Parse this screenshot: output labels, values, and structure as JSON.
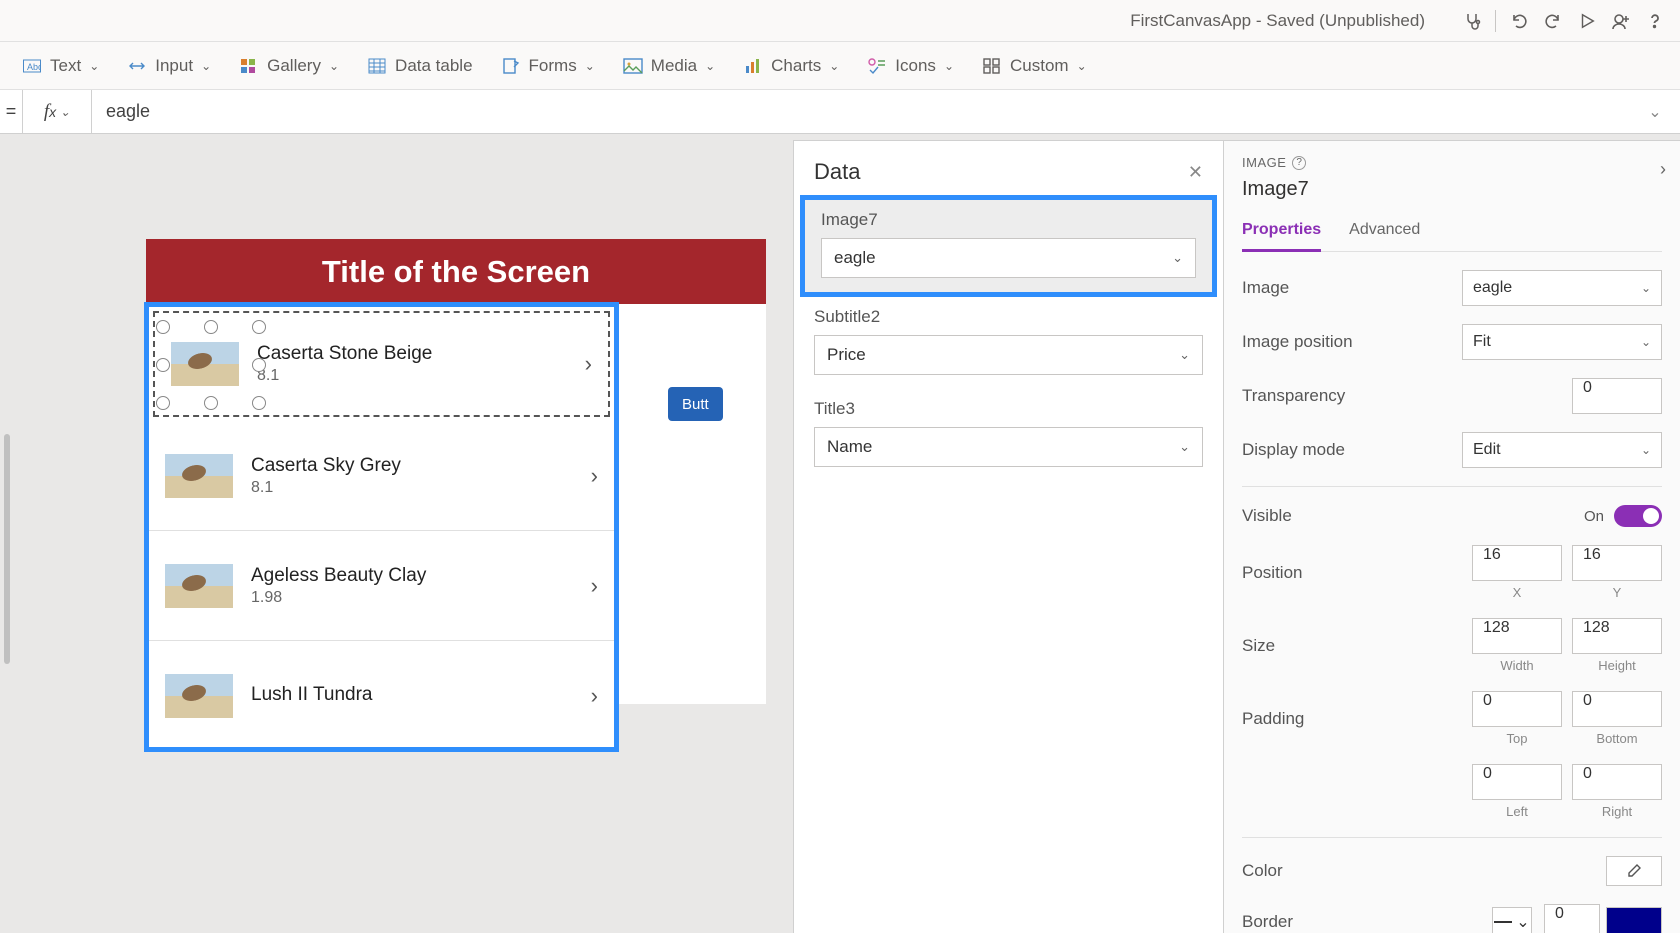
{
  "titlebar": {
    "app_title": "FirstCanvasApp - Saved (Unpublished)"
  },
  "ribbon": {
    "text": "Text",
    "input": "Input",
    "gallery": "Gallery",
    "datatable": "Data table",
    "forms": "Forms",
    "media": "Media",
    "charts": "Charts",
    "icons": "Icons",
    "custom": "Custom"
  },
  "formula": {
    "value": "eagle"
  },
  "canvas": {
    "header": "Title of the Screen",
    "button": "Butt",
    "rows": [
      {
        "title": "Caserta Stone Beige",
        "subtitle": "8.1"
      },
      {
        "title": "Caserta Sky Grey",
        "subtitle": "8.1"
      },
      {
        "title": "Ageless Beauty Clay",
        "subtitle": "1.98"
      },
      {
        "title": "Lush II Tundra",
        "subtitle": ""
      }
    ]
  },
  "data_panel": {
    "title": "Data",
    "groups": [
      {
        "label": "Image7",
        "value": "eagle"
      },
      {
        "label": "Subtitle2",
        "value": "Price"
      },
      {
        "label": "Title3",
        "value": "Name"
      }
    ]
  },
  "properties": {
    "type_label": "IMAGE",
    "control_name": "Image7",
    "tabs": {
      "properties": "Properties",
      "advanced": "Advanced"
    },
    "image_label": "Image",
    "image_value": "eagle",
    "position_label": "Image position",
    "position_value": "Fit",
    "transparency_label": "Transparency",
    "transparency_value": "0",
    "display_label": "Display mode",
    "display_value": "Edit",
    "visible_label": "Visible",
    "visible_value": "On",
    "pos_label": "Position",
    "pos_x": "16",
    "pos_y": "16",
    "x_label": "X",
    "y_label": "Y",
    "size_label": "Size",
    "size_w": "128",
    "size_h": "128",
    "w_label": "Width",
    "h_label": "Height",
    "padding_label": "Padding",
    "pad_top": "0",
    "pad_bottom": "0",
    "pad_left": "0",
    "pad_right": "0",
    "top_label": "Top",
    "bottom_label": "Bottom",
    "left_label": "Left",
    "right_label": "Right",
    "color_label": "Color",
    "border_label": "Border",
    "border_width": "0"
  }
}
